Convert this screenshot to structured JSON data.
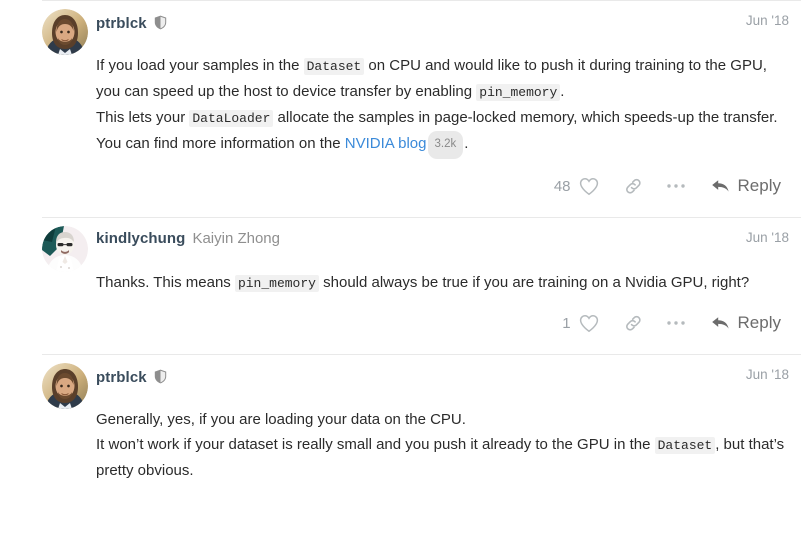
{
  "thread": {
    "posts": [
      {
        "username": "ptrblck",
        "fullname": "",
        "badge": "shield-icon",
        "date": "Jun '18",
        "lines": [
          [
            {
              "t": "text",
              "v": "If you load your samples in the "
            },
            {
              "t": "code",
              "v": "Dataset"
            },
            {
              "t": "text",
              "v": " on CPU and would like to push it during training to the GPU,"
            }
          ],
          [
            {
              "t": "text",
              "v": "you can speed up the host to device transfer by enabling "
            },
            {
              "t": "code",
              "v": "pin_memory"
            },
            {
              "t": "text",
              "v": "."
            }
          ],
          [
            {
              "t": "text",
              "v": "This lets your "
            },
            {
              "t": "code",
              "v": "DataLoader"
            },
            {
              "t": "text",
              "v": " allocate the samples in page-locked memory, which speeds-up the transfer."
            }
          ],
          [
            {
              "t": "text",
              "v": "You can find more information on the "
            },
            {
              "t": "link",
              "v": "NVIDIA blog"
            },
            {
              "t": "badge",
              "v": "3.2k"
            },
            {
              "t": "text",
              "v": "."
            }
          ]
        ],
        "actions": {
          "like_count": "48",
          "like_icon": "heart-icon",
          "link_icon": "link-icon",
          "more_icon": "ellipsis-icon",
          "reply_icon": "reply-arrow-icon",
          "reply_label": "Reply"
        }
      },
      {
        "username": "kindlychung",
        "fullname": "Kaiyin Zhong",
        "badge": "",
        "date": "Jun '18",
        "lines": [
          [
            {
              "t": "text",
              "v": "Thanks. This means "
            },
            {
              "t": "code",
              "v": "pin_memory"
            },
            {
              "t": "text",
              "v": " should always be true if you are training on a Nvidia GPU, right?"
            }
          ]
        ],
        "actions": {
          "like_count": "1",
          "like_icon": "heart-icon",
          "link_icon": "link-icon",
          "more_icon": "ellipsis-icon",
          "reply_icon": "reply-arrow-icon",
          "reply_label": "Reply"
        }
      },
      {
        "username": "ptrblck",
        "fullname": "",
        "badge": "shield-icon",
        "date": "Jun '18",
        "lines": [
          [
            {
              "t": "text",
              "v": "Generally, yes, if you are loading your data on the CPU."
            }
          ],
          [
            {
              "t": "text",
              "v": "It won’t work if your dataset is really small and you push it already to the GPU in the "
            },
            {
              "t": "code",
              "v": "Dataset"
            },
            {
              "t": "text",
              "v": ", but that’s"
            }
          ],
          [
            {
              "t": "text",
              "v": "pretty obvious."
            }
          ]
        ],
        "actions": null
      }
    ]
  },
  "colors": {
    "link": "#3b8ad9",
    "username": "#3a4c5c",
    "muted": "#9aa0a6",
    "divider": "#e9e9e9",
    "code_bg": "#f1f1f1"
  }
}
